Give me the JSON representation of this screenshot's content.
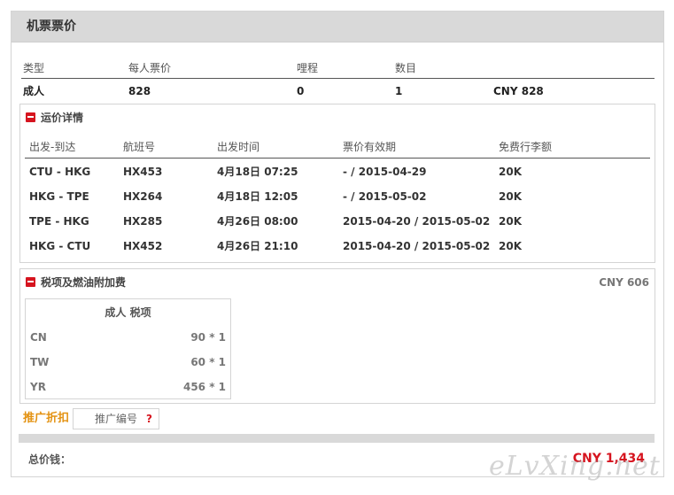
{
  "header": {
    "title": "机票票价"
  },
  "summary": {
    "columns": [
      "类型",
      "每人票价",
      "哩程",
      "数目"
    ],
    "row": {
      "type": "成人",
      "price": "828",
      "miles": "0",
      "count": "1",
      "total": "CNY 828"
    }
  },
  "fare_details": {
    "title": "运价详情",
    "columns": [
      "出发-到达",
      "航班号",
      "出发时间",
      "票价有效期",
      "免费行李额"
    ],
    "rows": [
      {
        "route": "CTU - HKG",
        "flight": "HX453",
        "departure": "4月18日 07:25",
        "validity": "- / 2015-04-29",
        "baggage": "20K"
      },
      {
        "route": "HKG - TPE",
        "flight": "HX264",
        "departure": "4月18日 12:05",
        "validity": "- / 2015-05-02",
        "baggage": "20K"
      },
      {
        "route": "TPE - HKG",
        "flight": "HX285",
        "departure": "4月26日 08:00",
        "validity": "2015-04-20 / 2015-05-02",
        "baggage": "20K"
      },
      {
        "route": "HKG - CTU",
        "flight": "HX452",
        "departure": "4月26日 21:10",
        "validity": "2015-04-20 / 2015-05-02",
        "baggage": "20K"
      }
    ]
  },
  "taxes": {
    "title": "税项及燃油附加费",
    "total": "CNY 606",
    "table_title": "成人 税项",
    "rows": [
      {
        "code": "CN",
        "amount": "90 * 1"
      },
      {
        "code": "TW",
        "amount": "60 * 1"
      },
      {
        "code": "YR",
        "amount": "456 * 1"
      }
    ]
  },
  "promo": {
    "label": "推广折扣",
    "placeholder": "推广编号",
    "help": "?"
  },
  "total": {
    "label": "总价钱：",
    "value": "CNY 1,434"
  },
  "watermark": "eLvXing.net",
  "colors": {
    "accent_red": "#d6141f",
    "promo_orange": "#e39212",
    "header_gray": "#d9d9d9"
  },
  "icons": {
    "collapse": "minus-icon",
    "help": "help-icon"
  }
}
